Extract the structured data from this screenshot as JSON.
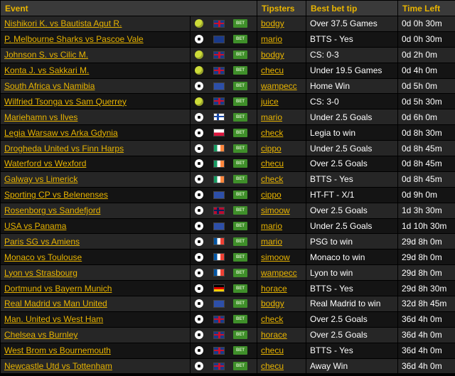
{
  "headers": {
    "event": "Event",
    "tipsters": "Tipsters",
    "tip": "Best bet tip",
    "time": "Time Left"
  },
  "bet_label": "BET",
  "rows": [
    {
      "event": "Nishikori K. vs Bautista Agut R.",
      "sport": "tennis",
      "flag": "uk",
      "tipster": "bodgy",
      "tip": "Over 37.5 Games",
      "time": "0d 0h 30m"
    },
    {
      "event": "P. Melbourne Sharks vs Pascoe Vale",
      "sport": "football",
      "flag": "au",
      "tipster": "mario",
      "tip": "BTTS - Yes",
      "time": "0d 0h 30m"
    },
    {
      "event": "Johnson S. vs Cilic M.",
      "sport": "tennis",
      "flag": "uk",
      "tipster": "bodgy",
      "tip": "CS: 0-3",
      "time": "0d 2h 0m"
    },
    {
      "event": "Konta J. vs Sakkari M.",
      "sport": "tennis",
      "flag": "uk",
      "tipster": "checu",
      "tip": "Under 19.5 Games",
      "time": "0d 4h 0m"
    },
    {
      "event": "South Africa vs Namibia",
      "sport": "football",
      "flag": "eu",
      "tipster": "wampecc",
      "tip": "Home Win",
      "time": "0d 5h 0m"
    },
    {
      "event": "Wilfried Tsonga vs Sam Querrey",
      "sport": "tennis",
      "flag": "uk",
      "tipster": "juice",
      "tip": "CS: 3-0",
      "time": "0d 5h 30m"
    },
    {
      "event": "Mariehamn vs Ilves",
      "sport": "football",
      "flag": "fi",
      "tipster": "mario",
      "tip": "Under 2.5 Goals",
      "time": "0d 6h 0m"
    },
    {
      "event": "Legia Warsaw vs Arka Gdynia",
      "sport": "football",
      "flag": "pl",
      "tipster": "check",
      "tip": "Legia to win",
      "time": "0d 8h 30m"
    },
    {
      "event": "Drogheda United vs Finn Harps",
      "sport": "football",
      "flag": "ie",
      "tipster": "cippo",
      "tip": "Under 2.5 Goals",
      "time": "0d 8h 45m"
    },
    {
      "event": "Waterford vs Wexford",
      "sport": "football",
      "flag": "ie",
      "tipster": "checu",
      "tip": "Over 2.5 Goals",
      "time": "0d 8h 45m"
    },
    {
      "event": "Galway vs Limerick",
      "sport": "football",
      "flag": "ie",
      "tipster": "check",
      "tip": "BTTS - Yes",
      "time": "0d 8h 45m"
    },
    {
      "event": "Sporting CP vs Belenenses",
      "sport": "football",
      "flag": "eu",
      "tipster": "cippo",
      "tip": "HT-FT - X/1",
      "time": "0d 9h 0m"
    },
    {
      "event": "Rosenborg vs Sandefjord",
      "sport": "football",
      "flag": "no",
      "tipster": "simoow",
      "tip": "Over 2.5 Goals",
      "time": "1d 3h 30m"
    },
    {
      "event": "USA vs Panama",
      "sport": "football",
      "flag": "eu",
      "tipster": "mario",
      "tip": "Under 2.5 Goals",
      "time": "1d 10h 30m"
    },
    {
      "event": "Paris SG vs Amiens",
      "sport": "football",
      "flag": "fr",
      "tipster": "mario",
      "tip": "PSG to win",
      "time": "29d 8h 0m"
    },
    {
      "event": "Monaco vs Toulouse",
      "sport": "football",
      "flag": "fr",
      "tipster": "simoow",
      "tip": "Monaco to win",
      "time": "29d 8h 0m"
    },
    {
      "event": "Lyon vs Strasbourg",
      "sport": "football",
      "flag": "fr",
      "tipster": "wampecc",
      "tip": "Lyon to win",
      "time": "29d 8h 0m"
    },
    {
      "event": "Dortmund vs Bayern Munich",
      "sport": "football",
      "flag": "de",
      "tipster": "horace",
      "tip": "BTTS - Yes",
      "time": "29d 8h 30m"
    },
    {
      "event": "Real Madrid vs Man United",
      "sport": "football",
      "flag": "eu",
      "tipster": "bodgy",
      "tip": "Real Madrid to win",
      "time": "32d 8h 45m"
    },
    {
      "event": "Man. United vs West Ham",
      "sport": "football",
      "flag": "uk",
      "tipster": "check",
      "tip": "Over 2.5 Goals",
      "time": "36d 4h 0m"
    },
    {
      "event": "Chelsea vs Burnley",
      "sport": "football",
      "flag": "uk",
      "tipster": "horace",
      "tip": "Over 2.5 Goals",
      "time": "36d 4h 0m"
    },
    {
      "event": "West Brom vs Bournemouth",
      "sport": "football",
      "flag": "uk",
      "tipster": "checu",
      "tip": "BTTS - Yes",
      "time": "36d 4h 0m"
    },
    {
      "event": "Newcastle Utd vs Tottenham",
      "sport": "football",
      "flag": "uk",
      "tipster": "checu",
      "tip": "Away Win",
      "time": "36d 4h 0m"
    }
  ]
}
